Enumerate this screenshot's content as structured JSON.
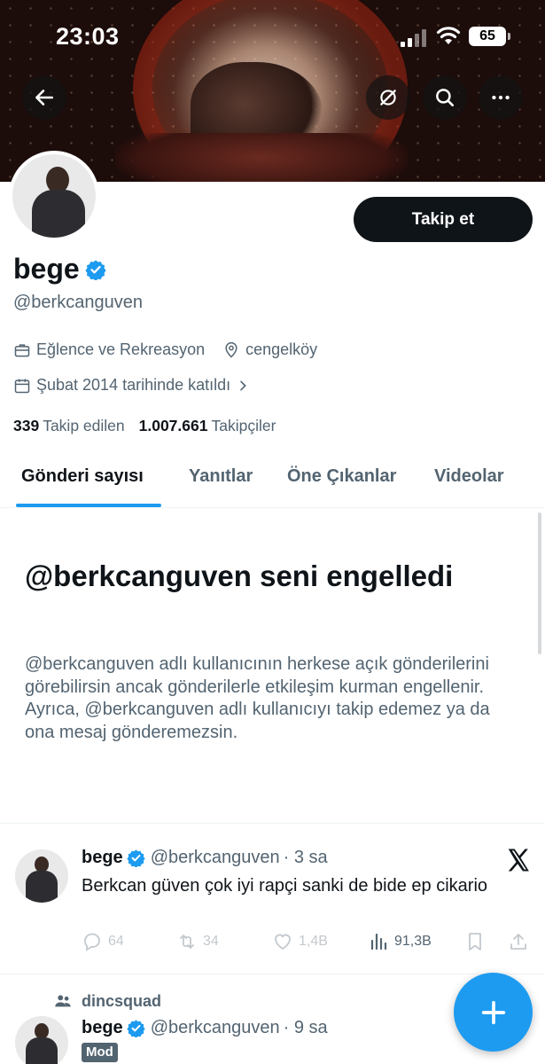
{
  "status_bar": {
    "time": "23:03",
    "battery": "65"
  },
  "top_bar": {
    "back": "back-arrow-icon",
    "grok": "grok-icon",
    "search": "search-icon",
    "more": "more-icon"
  },
  "profile": {
    "follow_label": "Takip et",
    "name": "bege",
    "handle": "@berkcanguven",
    "category": "Eğlence ve Rekreasyon",
    "location": "cengelköy",
    "joined": "Şubat 2014 tarihinde katıldı",
    "following_count": "339",
    "following_label": "Takip edilen",
    "followers_count": "1.007.661",
    "followers_label": "Takipçiler"
  },
  "tabs": [
    {
      "label": "Gönderi sayısı",
      "active": true
    },
    {
      "label": "Yanıtlar",
      "active": false
    },
    {
      "label": "Öne Çıkanlar",
      "active": false
    },
    {
      "label": "Videolar",
      "active": false
    }
  ],
  "blocked": {
    "title": "@berkcanguven seni engelledi",
    "description": "@berkcanguven adlı kullanıcının herkese açık gönderilerini görebilirsin ancak gönderilerle etkileşim kurman engellenir. Ayrıca, @berkcanguven adlı kullanıcıyı takip edemez ya da ona mesaj gönderemezsin."
  },
  "posts": [
    {
      "name": "bege",
      "handle": "@berkcanguven",
      "time": "· 3 sa",
      "text": "Berkcan güven çok iyi rapçi sanki de bide ep cikario",
      "replies": "64",
      "reposts": "34",
      "likes": "1,4B",
      "views": "91,3B"
    },
    {
      "community": "dincsquad",
      "name": "bege",
      "handle": "@berkcanguven",
      "time": "· 9 sa",
      "badge": "Mod"
    }
  ],
  "colors": {
    "accent": "#1d9bf0",
    "text": "#0f1419",
    "secondary": "#536471"
  }
}
